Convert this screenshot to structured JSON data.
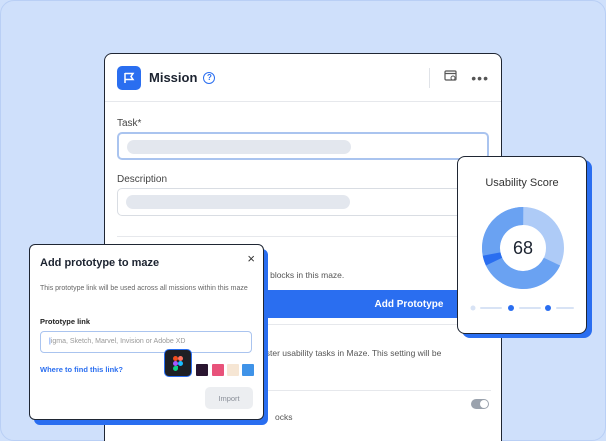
{
  "mission": {
    "title": "Mission",
    "help_icon": "question-circle-icon",
    "task_label": "Task*",
    "description_label": "Description",
    "blocks_text": "n blocks in this maze.",
    "add_prototype_label": "Add Prototype",
    "tester_text": "ester usability tasks in Maze. This setting will be",
    "bottom_text": "ocks"
  },
  "score": {
    "title": "Usability Score",
    "value": "68",
    "value_fraction": 0.68,
    "colors": {
      "primary": "#2a6ef0",
      "mid": "#6aa2f2",
      "light": "#aecbf7"
    }
  },
  "dialog": {
    "title": "Add prototype to maze",
    "close": "×",
    "description": "This prototype link will be used across all missions within this maze",
    "link_label": "Prototype link",
    "input_placeholder": "igma, Sketch, Marvel, Invision or Adobe XD",
    "help_link": "Where to find this link?",
    "import_label": "Import"
  },
  "swatches": [
    "#2a1530",
    "#e8527a",
    "#f6e6d4",
    "#3f93e8"
  ],
  "colors": {
    "accent": "#2a6ef0",
    "background": "#cfe0fb"
  }
}
